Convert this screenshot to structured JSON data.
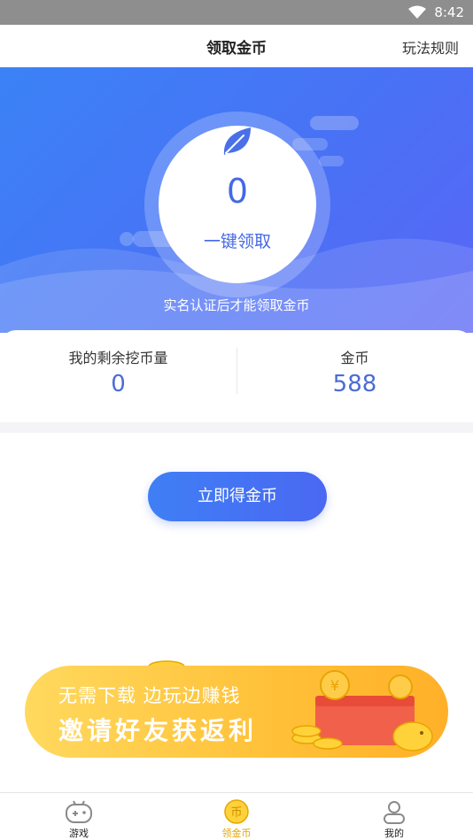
{
  "status_bar": {
    "time": "8:42",
    "icon": "wifi-icon"
  },
  "header": {
    "title": "领取金币",
    "rules_link": "玩法规则"
  },
  "hero": {
    "icon": "leaf-icon",
    "coin_count": "0",
    "claim_label": "一键领取",
    "hint": "实名认证后才能领取金币"
  },
  "stats": {
    "remaining": {
      "label": "我的剩余挖币量",
      "value": "0"
    },
    "coins": {
      "label": "金币",
      "value": "588"
    }
  },
  "cta": {
    "label": "立即得金币"
  },
  "banner": {
    "line1": "无需下载 边玩边赚钱",
    "line2": "邀请好友获返利"
  },
  "bottom_nav": {
    "items": [
      {
        "label": "游戏",
        "icon": "gamepad-icon",
        "active": false
      },
      {
        "label": "领金币",
        "icon": "coin-icon",
        "active": true
      },
      {
        "label": "我的",
        "icon": "user-icon",
        "active": false
      }
    ]
  },
  "colors": {
    "accent": "#4468e6",
    "hero_blue": "#3b82f6",
    "banner_yellow": "#ffc23a",
    "active_nav": "#e6a600"
  }
}
